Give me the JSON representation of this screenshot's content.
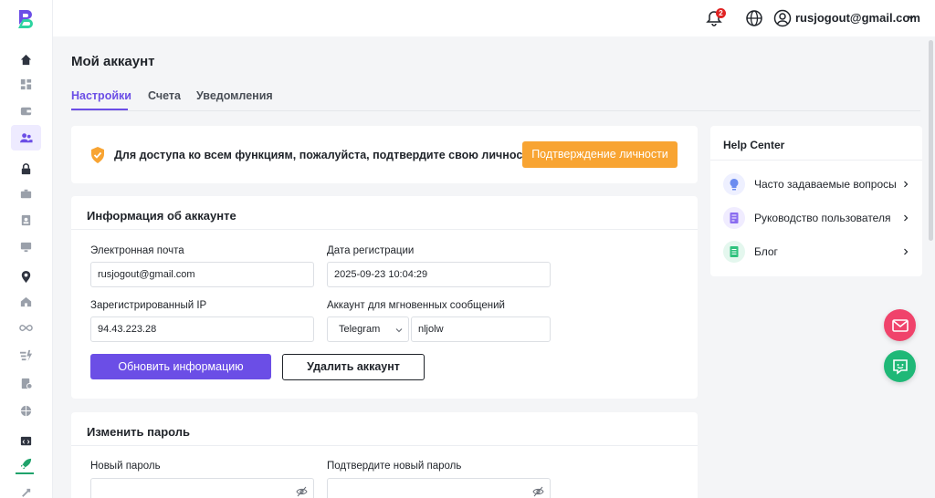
{
  "colors": {
    "accent": "#6b4ee6",
    "verify_button": "#f8a432",
    "badge": "#e02424",
    "fab_mail": "#f0436b",
    "fab_chat": "#1fb877"
  },
  "sidebar": {
    "items": [
      {
        "icon": "home-icon"
      },
      {
        "icon": "dashboard-icon"
      },
      {
        "icon": "wallet-icon"
      },
      {
        "icon": "users-icon",
        "active": true
      },
      {
        "icon": "lock-icon"
      },
      {
        "icon": "briefcase-icon"
      },
      {
        "icon": "contact-card-icon"
      },
      {
        "icon": "monitor-icon"
      },
      {
        "icon": "location-icon"
      },
      {
        "icon": "house-icon"
      },
      {
        "icon": "infinity-icon"
      },
      {
        "icon": "speed-icon"
      },
      {
        "icon": "document-icon"
      },
      {
        "icon": "globe-grid-icon"
      },
      {
        "icon": "code-window-icon"
      },
      {
        "icon": "rocket-icon"
      }
    ]
  },
  "topbar": {
    "notifications_count": "2",
    "user_email": "rusjogout@gmail.com"
  },
  "page": {
    "title": "Мой аккаунт",
    "tabs": [
      {
        "label": "Настройки",
        "active": true
      },
      {
        "label": "Счета"
      },
      {
        "label": "Уведомления"
      }
    ]
  },
  "verify": {
    "message": "Для доступа ко всем функциям, пожалуйста, подтвердите свою личность.",
    "button": "Подтверждение личности"
  },
  "account": {
    "title": "Информация об аккаунте",
    "email_label": "Электронная почта",
    "email_value": "rusjogout@gmail.com",
    "reg_date_label": "Дата регистрации",
    "reg_date_value": "2025-09-23 10:04:29",
    "ip_label": "Зарегистрированный IP",
    "ip_value": "94.43.223.28",
    "messenger_label": "Аккаунт для мгновенных сообщений",
    "messenger_type": "Telegram",
    "messenger_value": "nljolw",
    "update_button": "Обновить информацию",
    "delete_button": "Удалить аккаунт"
  },
  "password": {
    "title": "Изменить пароль",
    "new_label": "Новый пароль",
    "new_value": "",
    "confirm_label": "Подтвердите новый пароль",
    "confirm_value": ""
  },
  "help": {
    "title": "Help Center",
    "items": [
      {
        "label": "Часто задаваемые вопросы",
        "icon": "lightbulb-icon"
      },
      {
        "label": "Руководство пользователя",
        "icon": "guide-book-icon"
      },
      {
        "label": "Блог",
        "icon": "blog-icon"
      }
    ]
  }
}
